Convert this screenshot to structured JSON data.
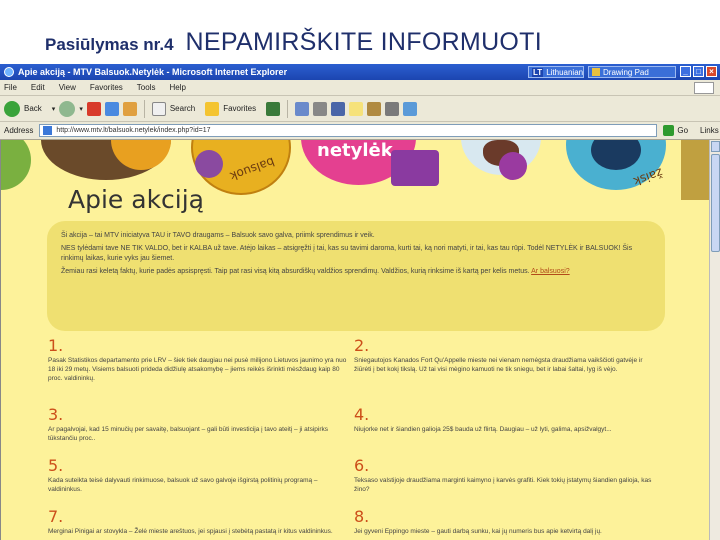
{
  "slide": {
    "title_bold": "Pasiūlymas nr.4",
    "title_main": "NEPAMIRŠKITE INFORMUOTI"
  },
  "browser": {
    "window_title": "Apie akciją - MTV Balsuok.Netylėk - Microsoft Internet Explorer",
    "taskbar_items": [
      "Lithuanian",
      "Drawing Pad"
    ],
    "menu": [
      "File",
      "Edit",
      "View",
      "Favorites",
      "Tools",
      "Help"
    ],
    "toolbar": {
      "back": "Back",
      "search": "Search",
      "favorites": "Favorites"
    },
    "address_label": "Address",
    "url": "http://www.mtv.lt/balsuok.netylek/index.php?id=17",
    "go": "Go",
    "links": "Links"
  },
  "page": {
    "heading": "Apie akciją",
    "banner_words": [
      "balsuok",
      "netylėk",
      "žaisk"
    ],
    "intro": [
      "Ši akcija – tai MTV iniciatyva TAU ir TAVO draugams – Balsuok savo galva, priimk sprendimus ir veik.",
      "NES tylėdami tave NE TIK VALDO, bet ir KALBA už tave. Atėjo laikas – atsigręžti į tai, kas su tavimi daroma, kurti tai, ką nori matyti, ir tai, kas tau rūpi. Todėl NETYLĖK ir BALSUOK! Šis rinkimų laikas, kurie vyks jau šiemet.",
      "Žemiau rasi keletą faktų, kurie padės apsispręsti. Taip pat rasi visą kitą absurdiškų valdžios sprendimų. Valdžios, kurią rinksime iš kartą per kelis metus.",
      "Ar balsuosi?"
    ],
    "items": [
      {
        "num": "1.",
        "text": "Pasak Statistikos departamento prie LRV – šiek tiek daugiau nei pusė milijono Lietuvos jaunimo yra nuo 18 iki 29 metų. Visiems balsuoti prideda didžiulę atsakomybę – jiems reikės išrinkti mėsždaug kaip 80 proc. valdininkų."
      },
      {
        "num": "2.",
        "text": "Sniegautojos Kanados Fort Qu'Appelle mieste nei vienam nemėgsta draudžiama vaikščioti gatvėje ir žiūrėti į bet kokį tikslą. Už tai visi mėgino kamuoti ne tik sniegu, bet ir labai šaltai, lyg iš vėjo."
      },
      {
        "num": "3.",
        "text": "Ar pagalvojai, kad 15 minučių per savaitę, balsuojant – gali būti investicija į tavo ateitį – ji atsipirks tūkstančiu proc.."
      },
      {
        "num": "4.",
        "text": "Niujorke net ir šiandien galioja 25$ bauda už flirtą. Daugiau – už lyti, galima, apsižvalgyt..."
      },
      {
        "num": "5.",
        "text": "Kada suteikta teisė dalyvauti rinkimuose, balsuok už savo galvoje išgirstą politinių programą – valdininkus."
      },
      {
        "num": "6.",
        "text": "Teksaso valstijoje draudžiama marginti kaimyno į karvės grafiti. Kiek tokių įstatymų šiandien galioja, kas žino?"
      },
      {
        "num": "7.",
        "text": "Merginai Pinigai ar stovykla – Želė mieste areštuos, jei spjausi į stebėtą pastatą ir kitus valdininkus."
      },
      {
        "num": "8.",
        "text": "Jei gyveni Eppingo mieste – gauti darbą sunku, kai jų numeris bus apie ketvirtą dalį jų."
      }
    ]
  },
  "colors": {
    "page_bg": "#fdf29a",
    "intro_bg": "#efe071",
    "number_color": "#cc4f1a",
    "title_color": "#1f2f6b"
  }
}
